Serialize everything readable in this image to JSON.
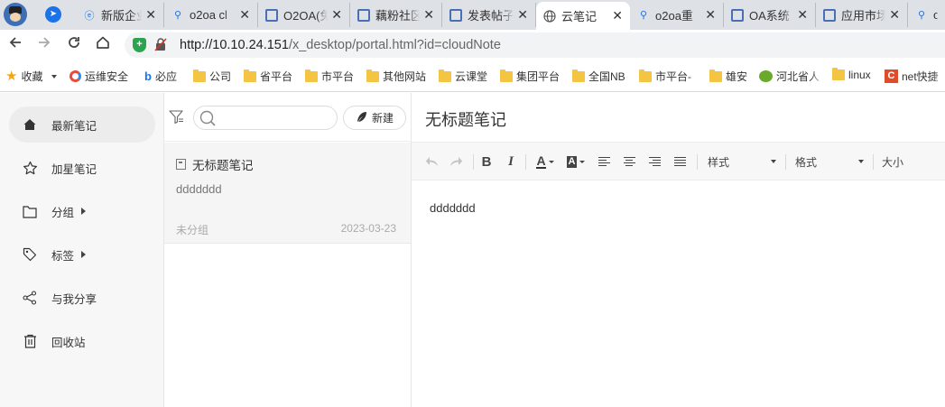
{
  "browser": {
    "tabs": [
      {
        "label": "新版企业",
        "icon": "e-icon"
      },
      {
        "label": "o2oa cl",
        "icon": "search-icon"
      },
      {
        "label": "O2OA(免",
        "icon": "o2-icon"
      },
      {
        "label": "藕粉社区",
        "icon": "o2-icon"
      },
      {
        "label": "发表帖子",
        "icon": "o2-icon"
      },
      {
        "label": "云笔记",
        "icon": "globe-icon",
        "active": true
      },
      {
        "label": "o2oa重",
        "icon": "search-icon"
      },
      {
        "label": "OA系统",
        "icon": "o2-icon"
      },
      {
        "label": "应用市场",
        "icon": "o2-icon"
      },
      {
        "label": "o",
        "icon": "search-icon"
      }
    ],
    "address": {
      "host": "http://10.10.24.151",
      "path": "/x_desktop/portal.html?id=cloudNote"
    },
    "bookmarks": [
      {
        "label": "收藏",
        "icon": "star-icon",
        "dropdown": true
      },
      {
        "label": "运维安全",
        "icon": "ring-icon"
      },
      {
        "label": "必应",
        "icon": "bing-icon"
      },
      {
        "label": "公司",
        "icon": "folder-icon"
      },
      {
        "label": "省平台",
        "icon": "folder-icon"
      },
      {
        "label": "市平台",
        "icon": "folder-icon"
      },
      {
        "label": "其他网站",
        "icon": "folder-icon"
      },
      {
        "label": "云课堂",
        "icon": "folder-icon"
      },
      {
        "label": "集团平台",
        "icon": "folder-icon"
      },
      {
        "label": "全国NB",
        "icon": "folder-icon"
      },
      {
        "label": "市平台-",
        "icon": "folder-icon"
      },
      {
        "label": "雄安",
        "icon": "folder-icon"
      },
      {
        "label": "河北省人",
        "icon": "frog-icon"
      },
      {
        "label": "linux",
        "icon": "folder-icon"
      },
      {
        "label": "net快捷",
        "icon": "c-icon"
      }
    ]
  },
  "sidebar": {
    "items": [
      {
        "label": "最新笔记",
        "icon": "home-icon",
        "active": true
      },
      {
        "label": "加星笔记",
        "icon": "star-outline-icon"
      },
      {
        "label": "分组",
        "icon": "folder-outline-icon",
        "expand": true
      },
      {
        "label": "标签",
        "icon": "tag-icon",
        "expand": true
      },
      {
        "label": "与我分享",
        "icon": "share-icon"
      },
      {
        "label": "回收站",
        "icon": "trash-icon"
      }
    ]
  },
  "notelist": {
    "search_placeholder": "",
    "new_label": "新建",
    "notes": [
      {
        "title": "无标题笔记",
        "summary": "ddddddd",
        "group": "未分组",
        "date": "2023-03-23"
      }
    ]
  },
  "editor": {
    "title": "无标题笔记",
    "style_label": "样式",
    "format_label": "格式",
    "size_label": "大小",
    "content": "ddddddd"
  }
}
